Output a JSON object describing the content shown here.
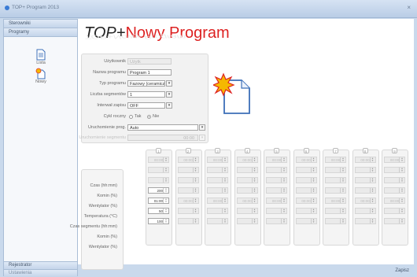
{
  "window": {
    "title": "TOP+ Program 2013"
  },
  "sidebar": {
    "header": "Sterowniki",
    "section": "Programy",
    "items": [
      {
        "label": "Lista",
        "icon": "document-list-icon"
      },
      {
        "label": "Nowy",
        "icon": "new-program-icon"
      }
    ],
    "footer": [
      "Rejestrator",
      "Ustawienia"
    ]
  },
  "page": {
    "title_prefix": "TOP+",
    "title_main": "Nowy Program"
  },
  "form": {
    "rows": [
      {
        "label": "Użytkownik",
        "value": "Użytk",
        "disabled": true,
        "dropdown": false
      },
      {
        "label": "Nazwa programu",
        "value": "Program 1",
        "disabled": false,
        "dropdown": false
      },
      {
        "label": "Typ programu",
        "value": "Fazowy (ceramiczny)",
        "disabled": false,
        "dropdown": true
      },
      {
        "label": "Liczba segmentów",
        "value": "1",
        "disabled": false,
        "dropdown": true
      },
      {
        "label": "Interwał zapisu",
        "value": "OFF",
        "disabled": false,
        "dropdown": true
      },
      {
        "label": "Cykl roczny",
        "value": "",
        "disabled": false,
        "dropdown": false
      },
      {
        "label": "Uruchomienie prog.",
        "value": "Auto",
        "disabled": false,
        "dropdown": true
      },
      {
        "label": "Uruchomienie segmentu",
        "value": "00:00",
        "disabled": true,
        "dropdown": false
      }
    ],
    "cycle_options": [
      {
        "label": "Tak",
        "selected": false
      },
      {
        "label": "Nie",
        "selected": true
      }
    ]
  },
  "segments": {
    "row_labels": [
      "Czas (hh:mm)",
      "Komin (%)",
      "Wentylator (%)",
      "Temperatura (°C)",
      "Czas segmentu (hh:mm)",
      "Komin (%)",
      "Wentylator (%)"
    ],
    "columns": [
      {
        "num": "1",
        "values": [
          "00:00",
          "",
          "",
          "200",
          "01:00",
          "50",
          "100"
        ],
        "active": [
          false,
          false,
          false,
          true,
          true,
          true,
          true
        ]
      },
      {
        "num": "2",
        "values": [
          "00:00",
          "",
          "",
          "",
          "00:00",
          "",
          ""
        ],
        "active": [
          false,
          false,
          false,
          false,
          false,
          false,
          false
        ]
      },
      {
        "num": "3",
        "values": [
          "00:00",
          "",
          "",
          "",
          "00:00",
          "",
          ""
        ],
        "active": [
          false,
          false,
          false,
          false,
          false,
          false,
          false
        ]
      },
      {
        "num": "4",
        "values": [
          "00:00",
          "",
          "",
          "",
          "00:00",
          "",
          ""
        ],
        "active": [
          false,
          false,
          false,
          false,
          false,
          false,
          false
        ]
      },
      {
        "num": "5",
        "values": [
          "00:00",
          "",
          "",
          "",
          "00:00",
          "",
          ""
        ],
        "active": [
          false,
          false,
          false,
          false,
          false,
          false,
          false
        ]
      },
      {
        "num": "6",
        "values": [
          "00:00",
          "",
          "",
          "",
          "00:00",
          "",
          ""
        ],
        "active": [
          false,
          false,
          false,
          false,
          false,
          false,
          false
        ]
      },
      {
        "num": "7",
        "values": [
          "00:00",
          "",
          "",
          "",
          "00:00",
          "",
          ""
        ],
        "active": [
          false,
          false,
          false,
          false,
          false,
          false,
          false
        ]
      },
      {
        "num": "8",
        "values": [
          "00:00",
          "",
          "",
          "",
          "00:00",
          "",
          ""
        ],
        "active": [
          false,
          false,
          false,
          false,
          false,
          false,
          false
        ]
      },
      {
        "num": "9",
        "values": [
          "00:00",
          "",
          "",
          "",
          "00:00",
          "",
          ""
        ],
        "active": [
          false,
          false,
          false,
          false,
          false,
          false,
          false
        ]
      }
    ]
  },
  "actions": {
    "save": "Zapisz"
  },
  "colors": {
    "title_accent": "#dd2222",
    "chrome_blue": "#c9d9ec",
    "icon_burst": "#f5b800"
  }
}
